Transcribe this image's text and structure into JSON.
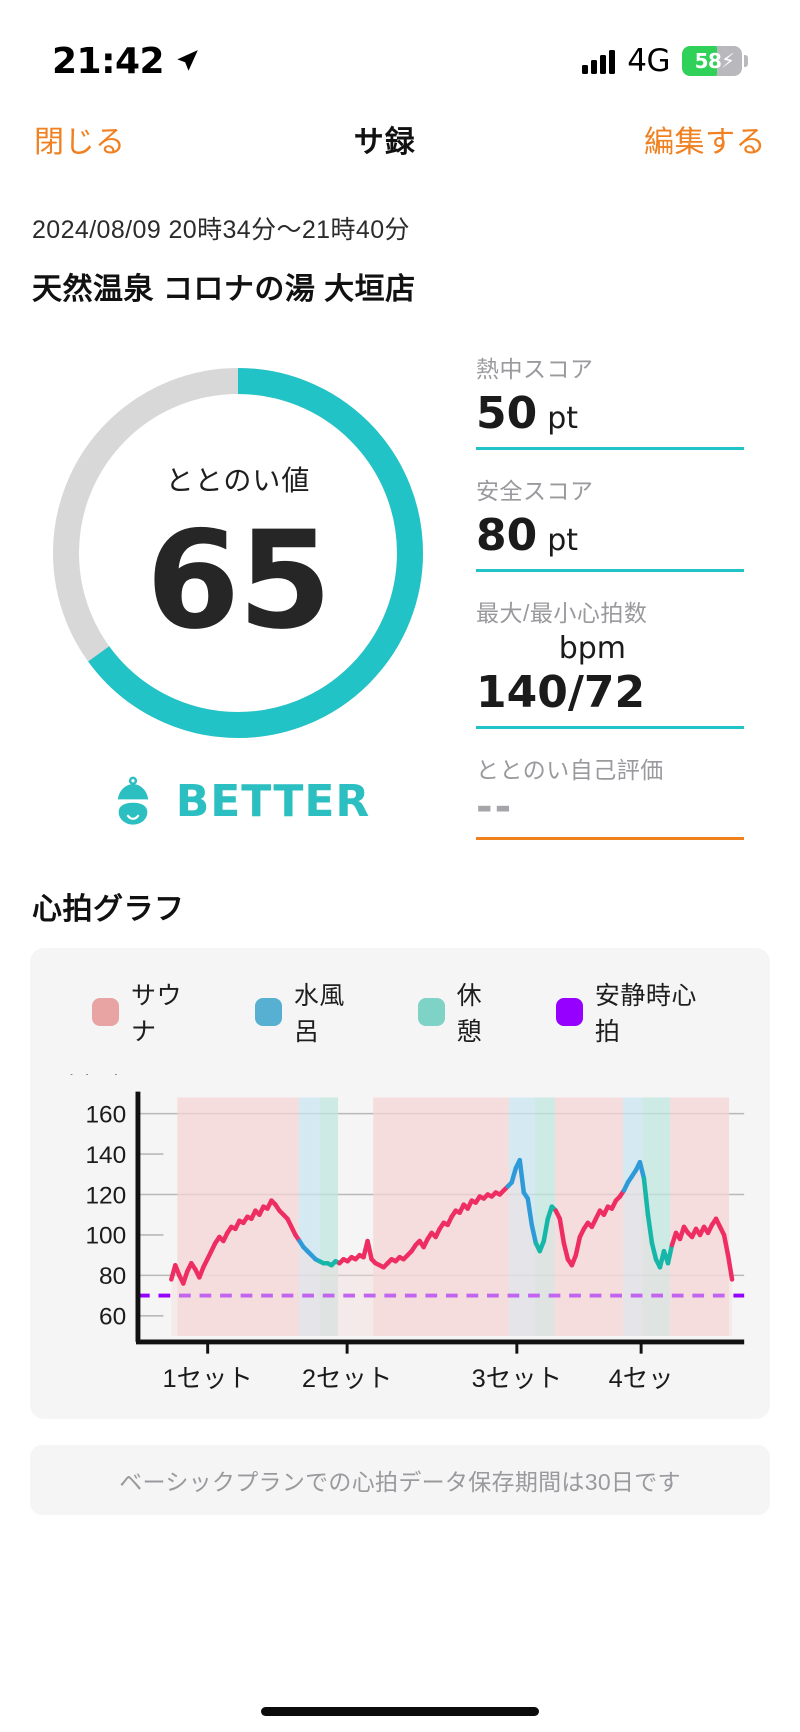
{
  "statusbar": {
    "time": "21:42",
    "network": "4G",
    "battery_pct": "58",
    "location_icon": "location-arrow-icon",
    "signal_icon": "cellular-bars-icon",
    "battery_icon": "battery-charging-icon"
  },
  "navbar": {
    "close_label": "閉じる",
    "title": "サ録",
    "edit_label": "編集する",
    "accent": "#F08020"
  },
  "header": {
    "date_range": "2024/08/09 20時34分〜21時40分",
    "venue": "天然温泉 コロナの湯 大垣店"
  },
  "gauge": {
    "caption": "ととのい値",
    "value": "65",
    "percent": 65,
    "track_color": "#D8D8D8",
    "progress_color": "#22C3C6",
    "rank_label": "BETTER",
    "rank_icon": "sauna-hat-face-icon"
  },
  "stats": [
    {
      "key": "熱中スコア",
      "value": "50",
      "unit": "pt",
      "rule_color": "#22C3C6",
      "wrap": false
    },
    {
      "key": "安全スコア",
      "value": "80",
      "unit": "pt",
      "rule_color": "#22C3C6",
      "wrap": false
    },
    {
      "key": "最大/最小心拍数",
      "value": "140/72",
      "unit": "bpm",
      "rule_color": "#22C3C6",
      "wrap": true
    },
    {
      "key": "ととのい自己評価",
      "value": "--",
      "unit": "",
      "rule_color": "#F0821E",
      "wrap": false,
      "muted": true
    }
  ],
  "chart_section": {
    "title": "心拍グラフ",
    "footer_note": "ベーシックプランでの心拍データ保存期間は30日です"
  },
  "chart_data": {
    "type": "line",
    "title": "心拍グラフ",
    "ylabel": "(bpm)",
    "xlabel": "",
    "ylim": [
      50,
      168
    ],
    "yticks": [
      60,
      80,
      100,
      120,
      140,
      160
    ],
    "ytick_labels": [
      "60",
      "80",
      "100",
      "120",
      "140",
      "160"
    ],
    "gridlines": [
      80,
      120,
      160
    ],
    "xtick_labels": [
      "1セット",
      "2セット",
      "3セット",
      "4セッ"
    ],
    "xtick_positions": [
      0.115,
      0.345,
      0.625,
      0.83
    ],
    "legend_position": "top",
    "legend": [
      {
        "label": "サウナ",
        "color": "#E8A3A3"
      },
      {
        "label": "水風呂",
        "color": "#57AFD1"
      },
      {
        "label": "休憩",
        "color": "#7FD2C6"
      },
      {
        "label": "安静時心拍",
        "color": "#9500FF"
      }
    ],
    "resting_hr": 70,
    "resting_hr_style": "dashed",
    "bands": [
      {
        "type": "サウナ",
        "x0": 0.065,
        "x1": 0.265,
        "color": "#F4D4D4"
      },
      {
        "type": "水風呂",
        "x0": 0.265,
        "x1": 0.3,
        "color": "#C9E4F0"
      },
      {
        "type": "休憩",
        "x0": 0.3,
        "x1": 0.33,
        "color": "#BFE6DF"
      },
      {
        "type": "サウナ",
        "x0": 0.388,
        "x1": 0.612,
        "color": "#F4D4D4"
      },
      {
        "type": "水風呂",
        "x0": 0.612,
        "x1": 0.655,
        "color": "#C9E4F0"
      },
      {
        "type": "休憩",
        "x0": 0.655,
        "x1": 0.688,
        "color": "#BFE6DF"
      },
      {
        "type": "サウナ",
        "x0": 0.688,
        "x1": 0.8,
        "color": "#F4D4D4"
      },
      {
        "type": "水風呂",
        "x0": 0.8,
        "x1": 0.832,
        "color": "#C9E4F0"
      },
      {
        "type": "休憩",
        "x0": 0.832,
        "x1": 0.878,
        "color": "#BFE6DF"
      },
      {
        "type": "サウナ",
        "x0": 0.878,
        "x1": 0.975,
        "color": "#F4D4D4"
      }
    ],
    "series": [
      {
        "name": "心拍数",
        "color_sauna": "#EE2E63",
        "color_cold": "#2E9BD8",
        "color_rest": "#16B6A8",
        "values": [
          78,
          85,
          80,
          76,
          82,
          86,
          83,
          79,
          84,
          88,
          92,
          96,
          99,
          97,
          101,
          104,
          103,
          107,
          106,
          109,
          108,
          112,
          110,
          114,
          113,
          117,
          115,
          112,
          110,
          108,
          104,
          100,
          97,
          94,
          92,
          90,
          88,
          87,
          86,
          86,
          85,
          87,
          86,
          88,
          87,
          89,
          88,
          90,
          89,
          97,
          88,
          86,
          85,
          84,
          86,
          88,
          87,
          89,
          88,
          90,
          92,
          95,
          97,
          94,
          98,
          101,
          99,
          103,
          106,
          105,
          109,
          112,
          111,
          115,
          113,
          117,
          116,
          119,
          118,
          120,
          119,
          121,
          120,
          122,
          124,
          126,
          133,
          137,
          121,
          118,
          105,
          96,
          92,
          97,
          108,
          114,
          112,
          108,
          96,
          88,
          85,
          90,
          99,
          103,
          106,
          104,
          108,
          112,
          110,
          114,
          113,
          117,
          119,
          122,
          126,
          129,
          132,
          136,
          128,
          110,
          96,
          88,
          84,
          92,
          86,
          95,
          101,
          98,
          104,
          101,
          99,
          103,
          100,
          104,
          101,
          105,
          108,
          104,
          100,
          90,
          78
        ]
      }
    ],
    "x_count": 141
  }
}
